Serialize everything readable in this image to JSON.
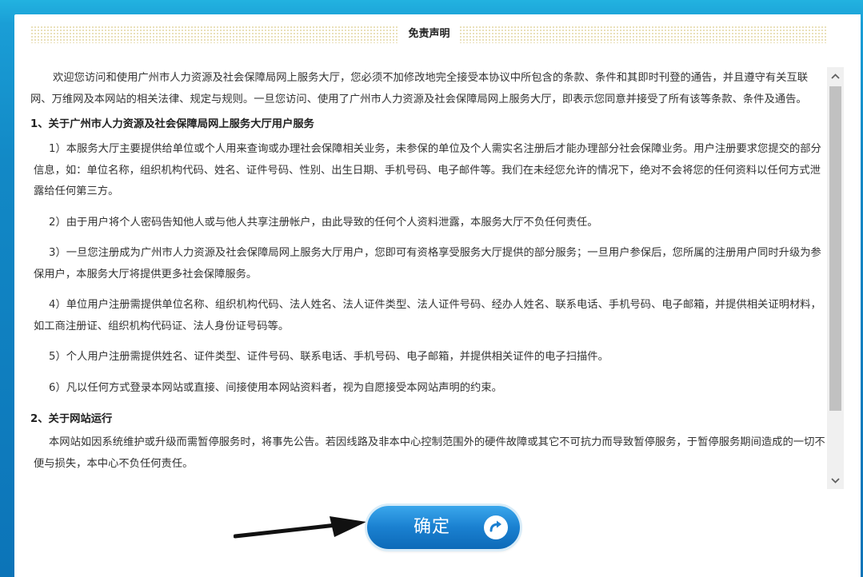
{
  "title": "免责声明",
  "intro": "欢迎您访问和使用广州市人力资源及社会保障局网上服务大厅，您必须不加修改地完全接受本协议中所包含的条款、条件和其即时刊登的通告，并且遵守有关互联网、万维网及本网站的相关法律、规定与规则。一旦您访问、使用了广州市人力资源及社会保障局网上服务大厅，即表示您同意并接受了所有该等条款、条件及通告。",
  "sections": [
    {
      "heading": "1、关于广州市人力资源及社会保障局网上服务大厅用户服务",
      "items": [
        "1）本服务大厅主要提供给单位或个人用来查询或办理社会保障相关业务，未参保的单位及个人需实名注册后才能办理部分社会保障业务。用户注册要求您提交的部分信息，如：单位名称，组织机构代码、姓名、证件号码、性别、出生日期、手机号码、电子邮件等。我们在未经您允许的情况下，绝对不会将您的任何资料以任何方式泄露给任何第三方。",
        "2）由于用户将个人密码告知他人或与他人共享注册帐户，由此导致的任何个人资料泄露，本服务大厅不负任何责任。",
        "3）一旦您注册成为广州市人力资源及社会保障局网上服务大厅用户，您即可有资格享受服务大厅提供的部分服务；一旦用户参保后，您所属的注册用户同时升级为参保用户，本服务大厅将提供更多社会保障服务。",
        "4）单位用户注册需提供单位名称、组织机构代码、法人姓名、法人证件类型、法人证件号码、经办人姓名、联系电话、手机号码、电子邮箱，并提供相关证明材料，如工商注册证、组织机构代码证、法人身份证号码等。",
        "5）个人用户注册需提供姓名、证件类型、证件号码、联系电话、手机号码、电子邮箱，并提供相关证件的电子扫描件。",
        "6）凡以任何方式登录本网站或直接、间接使用本网站资料者，视为自愿接受本网站声明的约束。"
      ]
    },
    {
      "heading": "2、关于网站运行",
      "items": [
        "本网站如因系统维护或升级而需暂停服务时，将事先公告。若因线路及非本中心控制范围外的硬件故障或其它不可抗力而导致暂停服务，于暂停服务期间造成的一切不便与损失，本中心不负任何责任。"
      ]
    }
  ],
  "confirm_button": "确定",
  "icons": {
    "scroll_up": "chevron-up-icon",
    "scroll_down": "chevron-down-icon",
    "confirm": "circular-arrow-icon",
    "annotation": "pointer-arrow-icon"
  }
}
